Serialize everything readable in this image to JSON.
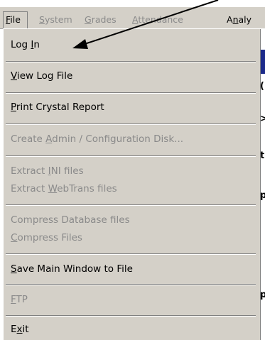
{
  "menubar": {
    "items": [
      {
        "pre": "",
        "u": "F",
        "post": "ile"
      },
      {
        "pre": "",
        "u": "S",
        "post": "ystem"
      },
      {
        "pre": "",
        "u": "G",
        "post": "rades"
      },
      {
        "pre": "",
        "u": "A",
        "post": "ttendance"
      },
      {
        "pre": "A",
        "u": "n",
        "post": "aly"
      }
    ]
  },
  "menu": {
    "items": [
      {
        "pre": "Log ",
        "u": "I",
        "post": "n",
        "enabled": true
      },
      {
        "pre": "",
        "u": "V",
        "post": "iew Log File",
        "enabled": true
      },
      {
        "pre": "",
        "u": "P",
        "post": "rint Crystal Report",
        "enabled": true
      },
      {
        "pre": "Create ",
        "u": "A",
        "post": "dmin / Configuration Disk...",
        "enabled": false
      },
      {
        "pre": "Extract ",
        "u": "I",
        "post": "NI files",
        "enabled": false
      },
      {
        "pre": "Extract ",
        "u": "W",
        "post": "ebTrans files",
        "enabled": false
      },
      {
        "pre": "Compress Database files",
        "u": "",
        "post": "",
        "enabled": false
      },
      {
        "pre": "",
        "u": "C",
        "post": "ompress Files",
        "enabled": false
      },
      {
        "pre": "",
        "u": "S",
        "post": "ave Main Window to File",
        "enabled": true
      },
      {
        "pre": "",
        "u": "F",
        "post": "TP",
        "enabled": false
      },
      {
        "pre": "E",
        "u": "x",
        "post": "it",
        "enabled": true
      }
    ]
  },
  "colors": {
    "menu_bg": "#d4d0c8",
    "disabled_text": "#8a8a8a",
    "enabled_text": "#000000"
  }
}
